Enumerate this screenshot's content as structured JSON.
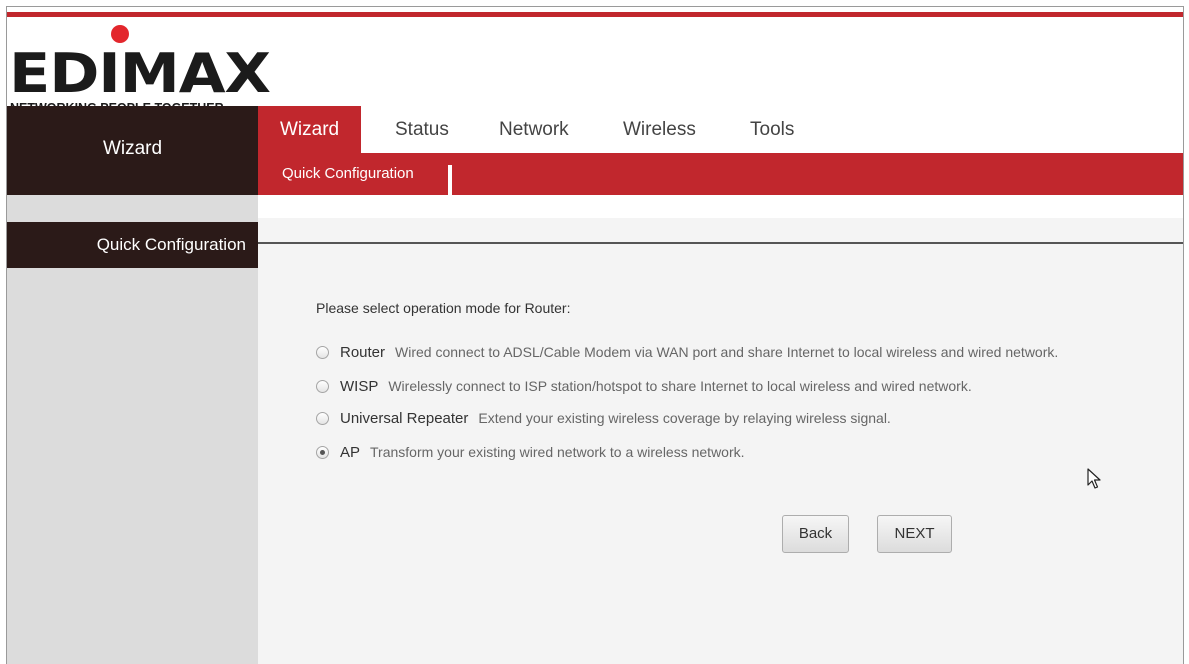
{
  "brand": {
    "name": "EDIMAX",
    "tagline": "NETWORKING PEOPLE TOGETHER",
    "accent_color": "#c1272d",
    "dark_color": "#2b1a18"
  },
  "left_header": {
    "label": "Wizard"
  },
  "nav": {
    "tabs": [
      {
        "label": "Wizard",
        "active": true
      },
      {
        "label": "Status",
        "active": false
      },
      {
        "label": "Network",
        "active": false
      },
      {
        "label": "Wireless",
        "active": false
      },
      {
        "label": "Tools",
        "active": false
      }
    ],
    "subtabs": [
      {
        "label": "Quick Configuration",
        "active": true
      }
    ]
  },
  "sidebar": {
    "items": [
      {
        "label": "Quick Configuration",
        "active": true
      }
    ]
  },
  "main": {
    "prompt": "Please select operation mode for Router:",
    "options": [
      {
        "name": "Router",
        "description": "Wired connect to ADSL/Cable Modem via WAN port and share Internet to local wireless and wired network.",
        "checked": false
      },
      {
        "name": "WISP",
        "description": "Wirelessly connect to ISP station/hotspot to share Internet to local wireless and wired network.",
        "checked": false
      },
      {
        "name": "Universal Repeater",
        "description": "Extend your existing wireless coverage by relaying wireless signal.",
        "checked": false
      },
      {
        "name": "AP",
        "description": "Transform your existing wired network to a wireless network.",
        "checked": true
      }
    ],
    "buttons": {
      "back": "Back",
      "next": "NEXT"
    }
  },
  "icons": {
    "cursor": "mouse-pointer-icon"
  }
}
